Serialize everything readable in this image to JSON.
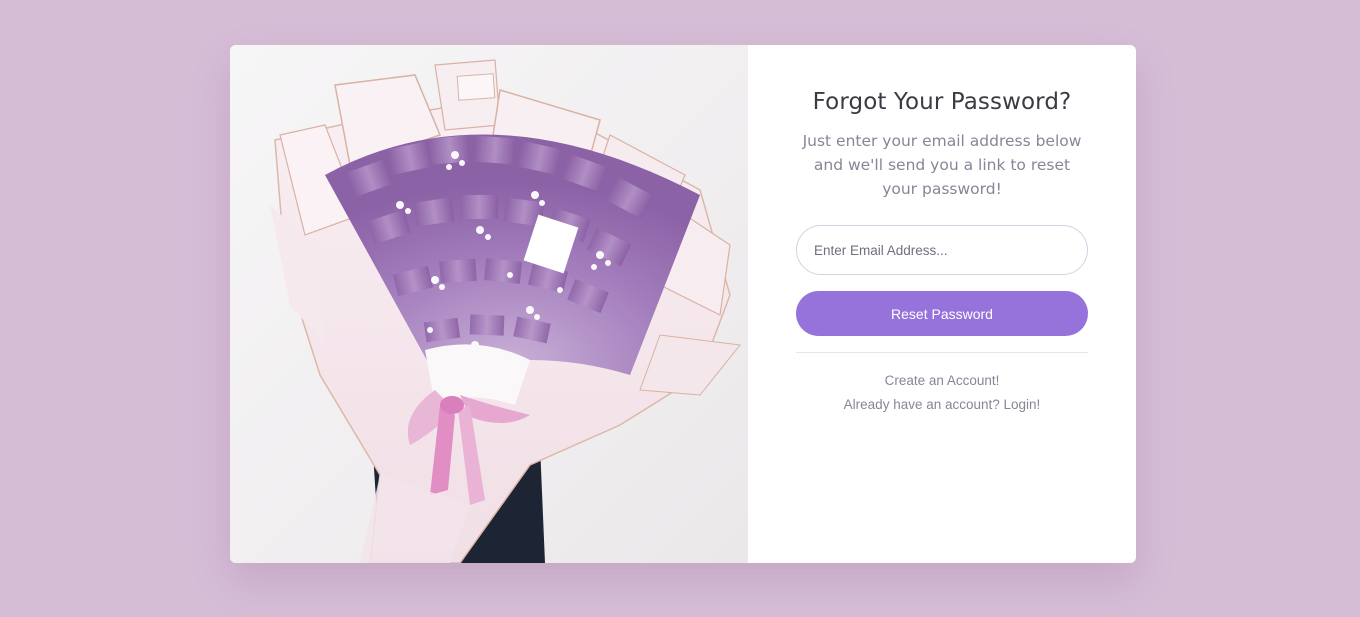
{
  "form": {
    "title": "Forgot Your Password?",
    "subtitle": "Just enter your email address below and we'll send you a link to reset your password!",
    "email_placeholder": "Enter Email Address...",
    "email_value": "",
    "reset_label": "Reset Password"
  },
  "links": {
    "create_account": "Create an Account!",
    "login": "Already have an account? Login!"
  },
  "image": {
    "subject": "money-bouquet-photo"
  },
  "colors": {
    "page_background": "#d6bdd6",
    "accent": "#9673db",
    "title_text": "#3a3b45",
    "muted_text": "#858796"
  }
}
